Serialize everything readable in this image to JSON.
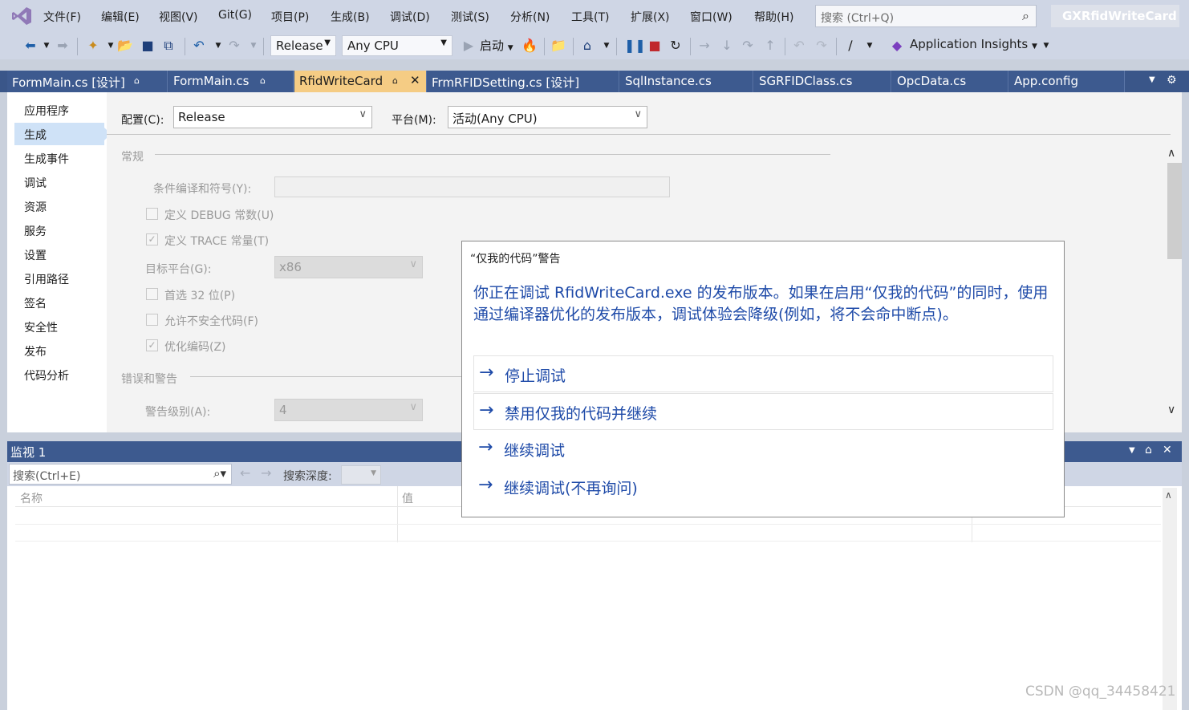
{
  "menu": {
    "items": [
      "文件(F)",
      "编辑(E)",
      "视图(V)",
      "Git(G)",
      "项目(P)",
      "生成(B)",
      "调试(D)",
      "测试(S)",
      "分析(N)",
      "工具(T)",
      "扩展(X)",
      "窗口(W)",
      "帮助(H)"
    ],
    "search_placeholder": "搜索 (Ctrl+Q)",
    "solution_name": "GXRfidWriteCard"
  },
  "toolbar": {
    "configuration": "Release",
    "platform": "Any CPU",
    "start_label": "启动",
    "app_insights": "Application Insights"
  },
  "tabs": [
    "FormMain.cs [设计]",
    "FormMain.cs",
    "RfidWriteCard",
    "FrmRFIDSetting.cs [设计]",
    "SqlInstance.cs",
    "SGRFIDClass.cs",
    "OpcData.cs",
    "App.config"
  ],
  "sidebar": {
    "items": [
      "应用程序",
      "生成",
      "生成事件",
      "调试",
      "资源",
      "服务",
      "设置",
      "引用路径",
      "签名",
      "安全性",
      "发布",
      "代码分析"
    ],
    "selected_index": 1
  },
  "build": {
    "config_label": "配置(C):",
    "config_value": "Release",
    "platform_label": "平台(M):",
    "platform_value": "活动(Any CPU)",
    "general_header": "常规",
    "conditional_symbols_label": "条件编译和符号(Y):",
    "define_debug": "定义 DEBUG 常数(U)",
    "define_trace": "定义 TRACE 常量(T)",
    "target_platform_label": "目标平台(G):",
    "target_platform_value": "x86",
    "prefer32": "首选 32 位(P)",
    "allow_unsafe": "允许不安全代码(F)",
    "optimize": "优化编码(Z)",
    "errors_header": "错误和警告",
    "warning_level_label": "警告级别(A):",
    "warning_level_value": "4"
  },
  "watch": {
    "title": "监视 1",
    "search_placeholder": "搜索(Ctrl+E)",
    "depth_label": "搜索深度:",
    "col_name": "名称",
    "col_value": "值"
  },
  "dialog": {
    "title": "“仅我的代码”警告",
    "message": "你正在调试 RfidWriteCard.exe 的发布版本。如果在启用“仅我的代码”的同时，使用通过编译器优化的发布版本，调试体验会降级(例如，将不会命中断点)。",
    "options": [
      "停止调试",
      "禁用仅我的代码并继续",
      "继续调试",
      "继续调试(不再询问)"
    ]
  },
  "watermark": "CSDN @qq_34458421",
  "colors": {
    "accent_tab": "#f5cc84",
    "link_blue": "#1e4aa8",
    "titlebar_blue": "#3d5a8f"
  }
}
